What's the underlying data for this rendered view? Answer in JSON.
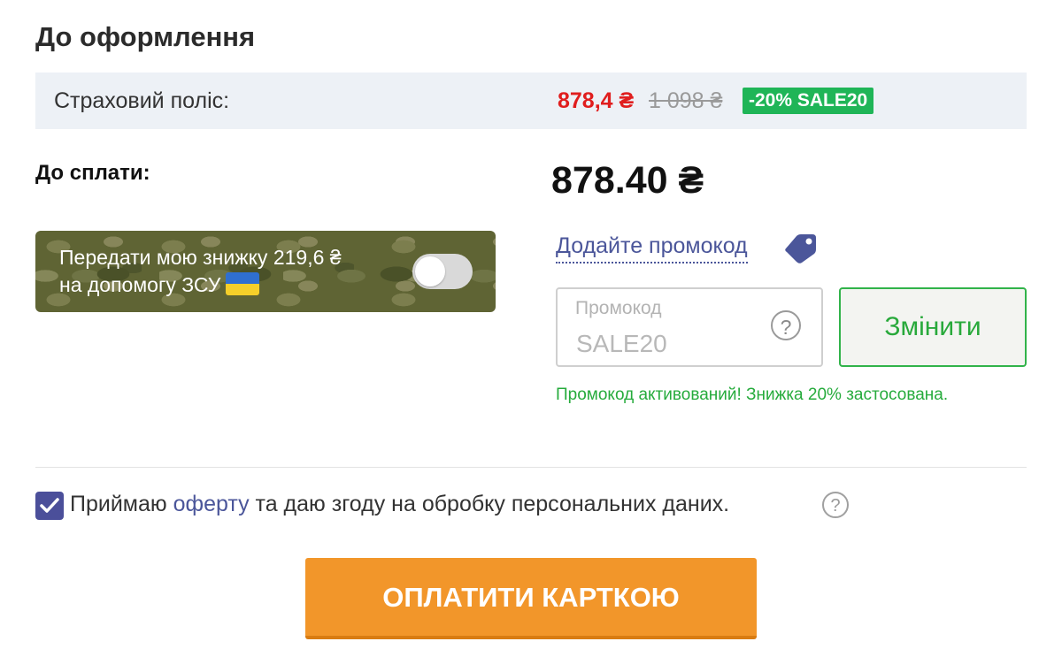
{
  "header": {
    "title": "До оформлення"
  },
  "policy": {
    "label": "Страховий поліс:",
    "price_new": "878,4 ₴",
    "price_old": "1 098 ₴",
    "discount_badge": "-20% SALE20"
  },
  "total": {
    "label": "До сплати:",
    "amount": "878.40 ₴"
  },
  "donate": {
    "line1": "Передати мою знижку 219,6 ₴",
    "line2": "на допомогу ЗСУ",
    "toggle_on": false
  },
  "promo": {
    "link_text": "Додайте промокод",
    "placeholder": "Промокод",
    "value": "SALE20",
    "help_symbol": "?",
    "change_label": "Змінити",
    "success_message": "Промокод активований! Знижка 20% застосована."
  },
  "consent": {
    "checked": true,
    "prefix": "Приймаю",
    "link": "оферту",
    "suffix": "та даю згоду на обробку персональних даних.",
    "help_symbol": "?"
  },
  "pay": {
    "label": "ОПЛАТИТИ КАРТКОЮ"
  },
  "colors": {
    "accent": "#f2962a",
    "price_red": "#e01e1e",
    "success_green": "#26ab3c",
    "link_blue": "#4b569a"
  }
}
